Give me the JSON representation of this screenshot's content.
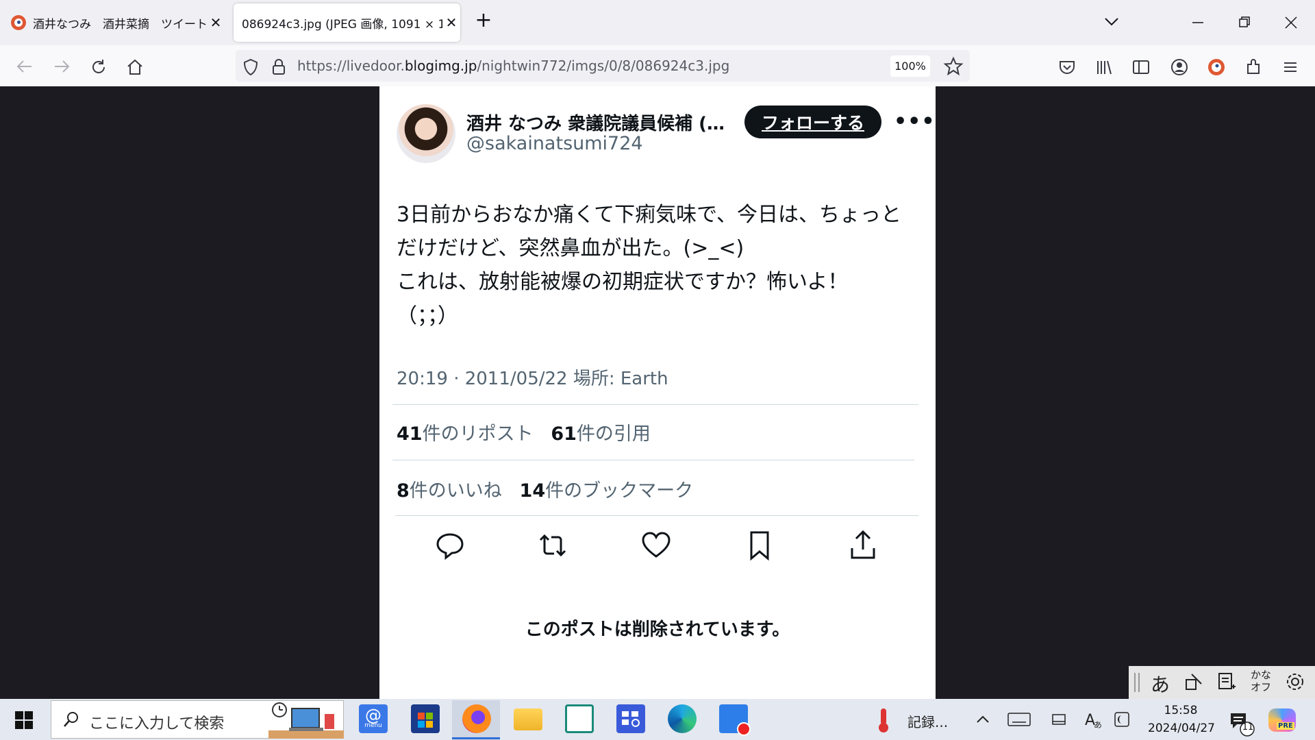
{
  "browser": {
    "tabs": [
      {
        "title": "酒井なつみ　酒井菜摘　ツイート",
        "active": false
      },
      {
        "title": "086924c3.jpg (JPEG 画像, 1091 × 12",
        "active": true
      }
    ],
    "url_prefix": "https://livedoor.",
    "url_domain": "blogimg.jp",
    "url_path": "/nightwin772/imgs/0/8/086924c3.jpg",
    "zoom": "100%",
    "new_tab_glyph": "+",
    "close_glyph": "✕"
  },
  "tweet": {
    "display_name": "酒井 なつみ 衆議院議員候補 (…",
    "handle": "@sakainatsumi724",
    "follow_label": "フォローする",
    "more_glyph": "•••",
    "lines": [
      "3日前からおなか痛くて下痢気味で、今日は、ちょっと",
      "だけだけど、突然鼻血が出た。(>_<)",
      "これは、放射能被爆の初期症状ですか？怖いよ！",
      "（；；）"
    ],
    "meta": "20:19 · 2011/05/22  場所: Earth",
    "stats": {
      "reposts": {
        "count": "41",
        "label": "件のリポスト"
      },
      "quotes": {
        "count": "61",
        "label": "件の引用"
      },
      "likes": {
        "count": "8",
        "label": "件のいいね"
      },
      "bookmarks": {
        "count": "14",
        "label": "件のブックマーク"
      }
    },
    "deleted_notice": "このポストは削除されています。"
  },
  "ime": {
    "kana": "かな",
    "off": "オフ",
    "mode_glyph": "あ"
  },
  "taskbar": {
    "search_placeholder": "ここに入力して検索",
    "recording_label": "記録...",
    "time": "15:58",
    "date": "2024/04/27",
    "notification_count": "11",
    "mail_label": "menu",
    "copilot_badge": "PRE"
  },
  "colors": {
    "brand_dark": "#0f1419",
    "secondary_text": "#536471",
    "firefox_bg": "#1c1b22"
  }
}
